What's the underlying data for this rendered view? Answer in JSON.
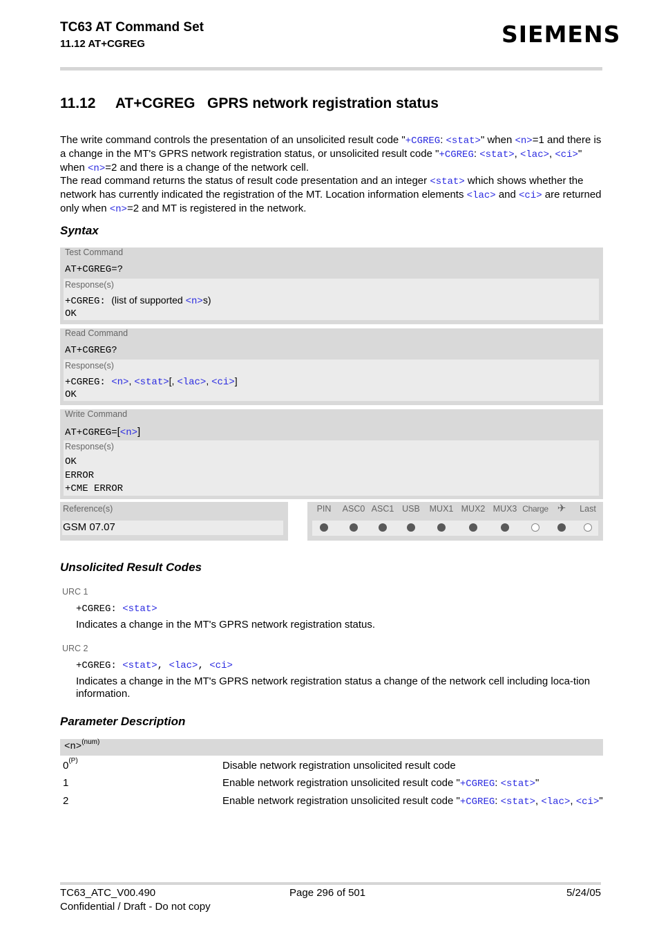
{
  "header": {
    "title": "TC63 AT Command Set",
    "subtitle": "11.12 AT+CGREG",
    "logo": "SIEMENS"
  },
  "section": {
    "number": "11.12",
    "command": "AT+CGREG",
    "title": "GPRS network registration status"
  },
  "intro": {
    "p1_a": "The write command controls the presentation of an unsolicited result code \"",
    "p1_code1": "+CGREG",
    "p1_colon": ": ",
    "p1_stat": "<stat>",
    "p1_b": "\" when ",
    "p1_n": "<n>",
    "p1_c": "=1 and there is a change in the MT's GPRS network registration status, or unsolicited result code \"",
    "p1_code2": "+CGREG",
    "p1_colon2": ": ",
    "p1_stat2": "<stat>",
    "p1_comma": ", ",
    "p1_lac": "<lac>",
    "p1_comma2": ", ",
    "p1_ci": "<ci>",
    "p1_d": "\" when ",
    "p1_n2": "<n>",
    "p1_e": "=2 and there is a change of the network cell.",
    "p2_a": "The read command returns the status of result code presentation and an integer ",
    "p2_stat": "<stat>",
    "p2_b": " which shows whether the network has currently indicated the registration of the MT. Location information elements ",
    "p2_lac": "<lac>",
    "p2_and": " and ",
    "p2_ci": "<ci>",
    "p2_c": " are returned only when ",
    "p2_n": "<n>",
    "p2_d": "=2 and MT is registered in the network."
  },
  "syntax": {
    "heading": "Syntax",
    "test": {
      "label": "Test Command",
      "command": "AT+CGREG=?",
      "resp_label": "Response(s)",
      "resp_prefix": "+CGREG: ",
      "resp_text_a": " (list of supported ",
      "resp_n": "<n>",
      "resp_text_b": "s)",
      "resp_ok": "OK"
    },
    "read": {
      "label": "Read Command",
      "command": "AT+CGREG?",
      "resp_label": "Response(s)",
      "resp_prefix": "+CGREG: ",
      "resp_n": "<n>",
      "sep1": ", ",
      "resp_stat": "<stat>",
      "bracket_open": "[, ",
      "resp_lac": "<lac>",
      "sep2": ", ",
      "resp_ci": "<ci>",
      "bracket_close": "]",
      "resp_ok": "OK"
    },
    "write": {
      "label": "Write Command",
      "command_a": "AT+CGREG=",
      "bracket_open": "[",
      "command_n": "<n>",
      "bracket_close": "]",
      "resp_label": "Response(s)",
      "responses": [
        "OK",
        "ERROR",
        "+CME ERROR"
      ]
    },
    "reference": {
      "label": "Reference(s)",
      "value": "GSM 07.07"
    },
    "availability": {
      "columns": [
        "PIN",
        "ASC0",
        "ASC1",
        "USB",
        "MUX1",
        "MUX2",
        "MUX3",
        "Charge",
        "✈",
        "Last"
      ],
      "values": [
        true,
        true,
        true,
        true,
        true,
        true,
        true,
        false,
        true,
        false
      ]
    }
  },
  "urc": {
    "heading": "Unsolicited Result Codes",
    "items": [
      {
        "label": "URC 1",
        "prefix": "+CGREG: ",
        "stat": "<stat>",
        "desc": "Indicates a change in the MT's GPRS network registration status."
      },
      {
        "label": "URC 2",
        "prefix": "+CGREG: ",
        "stat": "<stat>",
        "sep1": ", ",
        "lac": "<lac>",
        "sep2": ", ",
        "ci": "<ci>",
        "desc": "Indicates a change in the MT's GPRS network registration status a change of the network cell including loca-tion information."
      }
    ]
  },
  "params": {
    "heading": "Parameter Description",
    "name": "<n>",
    "name_sup": "(num)",
    "rows": [
      {
        "value": "0",
        "sup": "(P)",
        "desc": "Disable network registration unsolicited result code"
      },
      {
        "value": "1",
        "desc_a": "Enable network registration unsolicited result code \"",
        "code": "+CGREG",
        "colon": ": ",
        "stat": "<stat>",
        "desc_b": "\""
      },
      {
        "value": "2",
        "desc_a": "Enable network registration unsolicited result code \"",
        "code": "+CGREG",
        "colon": ": ",
        "stat": "<stat>",
        "sep1": ", ",
        "lac": "<lac>",
        "sep2": ", ",
        "ci": "<ci>",
        "desc_b": "\""
      }
    ]
  },
  "footer": {
    "doc_id": "TC63_ATC_V00.490",
    "page": "Page 296 of 501",
    "date": "5/24/05",
    "notice": "Confidential / Draft - Do not copy"
  }
}
